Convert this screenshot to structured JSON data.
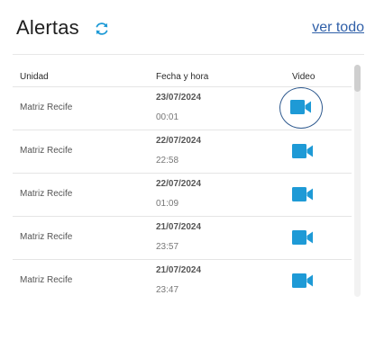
{
  "header": {
    "title": "Alertas",
    "refresh_icon": "refresh-icon",
    "view_all_label": "ver todo"
  },
  "table": {
    "columns": [
      "Unidad",
      "Fecha y hora",
      "Video"
    ],
    "rows": [
      {
        "unit": "Matriz Recife",
        "date": "23/07/2024",
        "time": "00:01",
        "video_icon": "video-camera-icon"
      },
      {
        "unit": "Matriz Recife",
        "date": "22/07/2024",
        "time": "22:58",
        "video_icon": "video-camera-icon"
      },
      {
        "unit": "Matriz Recife",
        "date": "22/07/2024",
        "time": "01:09",
        "video_icon": "video-camera-icon"
      },
      {
        "unit": "Matriz Recife",
        "date": "21/07/2024",
        "time": "23:57",
        "video_icon": "video-camera-icon"
      },
      {
        "unit": "Matriz Recife",
        "date": "21/07/2024",
        "time": "23:47",
        "video_icon": "video-camera-icon"
      }
    ]
  },
  "colors": {
    "accent": "#1e9ad6",
    "link": "#2f5fa8",
    "highlight_ring": "#2f5a8f"
  }
}
